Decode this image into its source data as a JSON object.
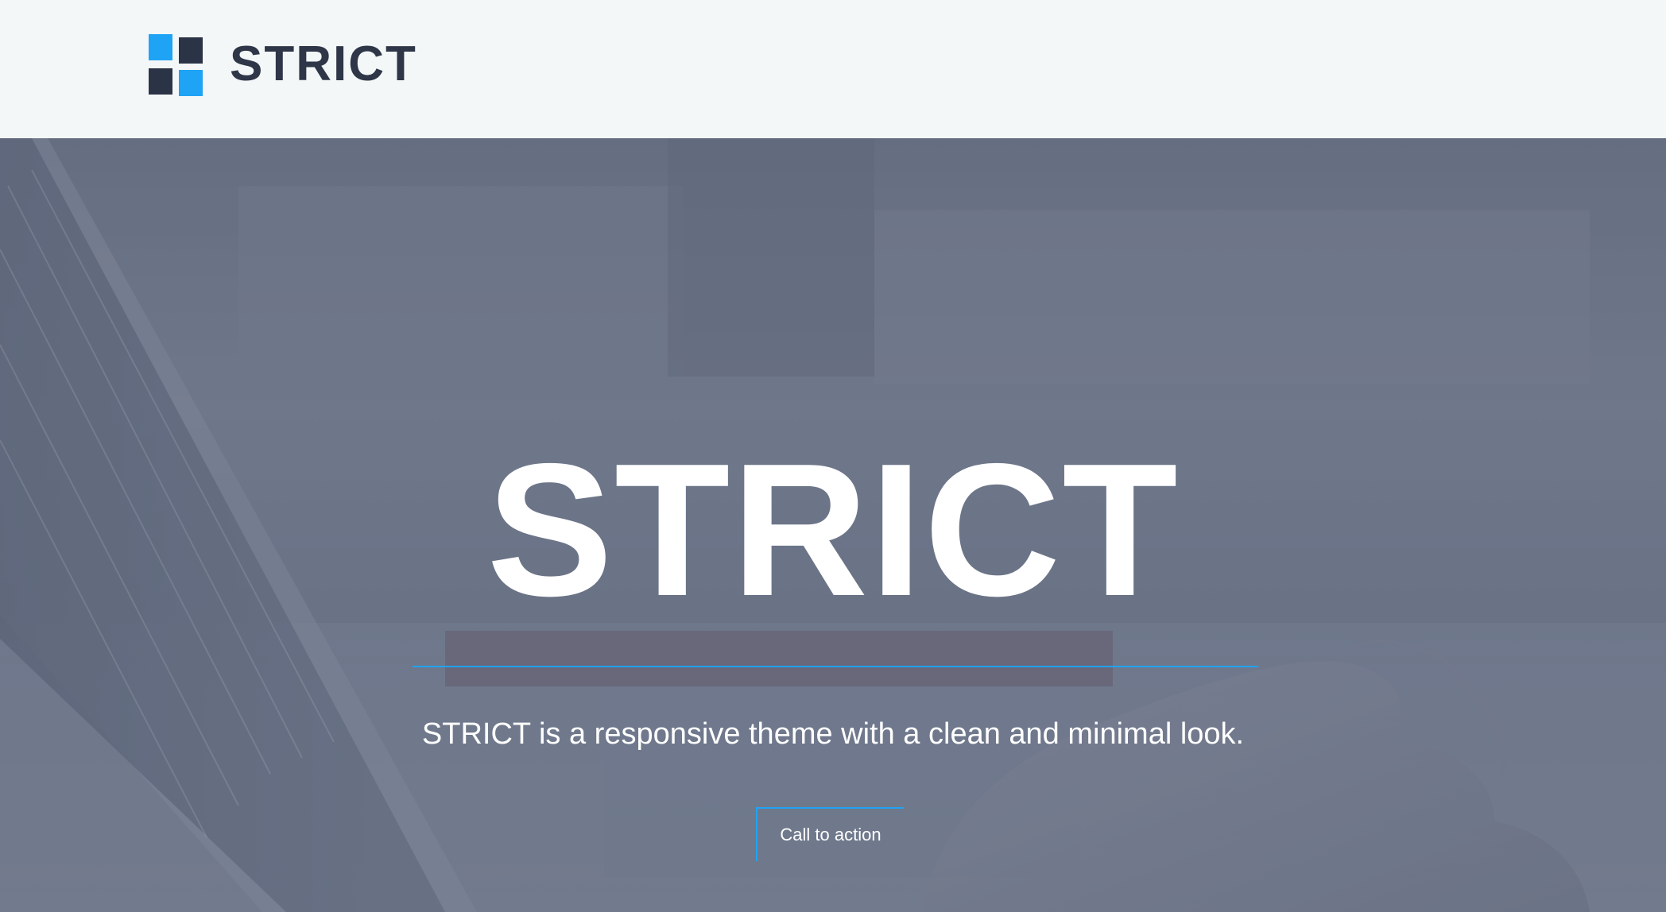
{
  "header": {
    "logo_text": "STRICT"
  },
  "hero": {
    "title": "STRICT",
    "subtitle": "STRICT is a responsive theme with a clean and minimal look.",
    "cta_label": "Call to action"
  },
  "colors": {
    "accent": "#1fa3f5",
    "brand_dark": "#2b3446",
    "header_bg": "#f4f7f8",
    "hero_text": "#ffffff"
  },
  "icons": {
    "logo": "four-square-grid-logo"
  }
}
